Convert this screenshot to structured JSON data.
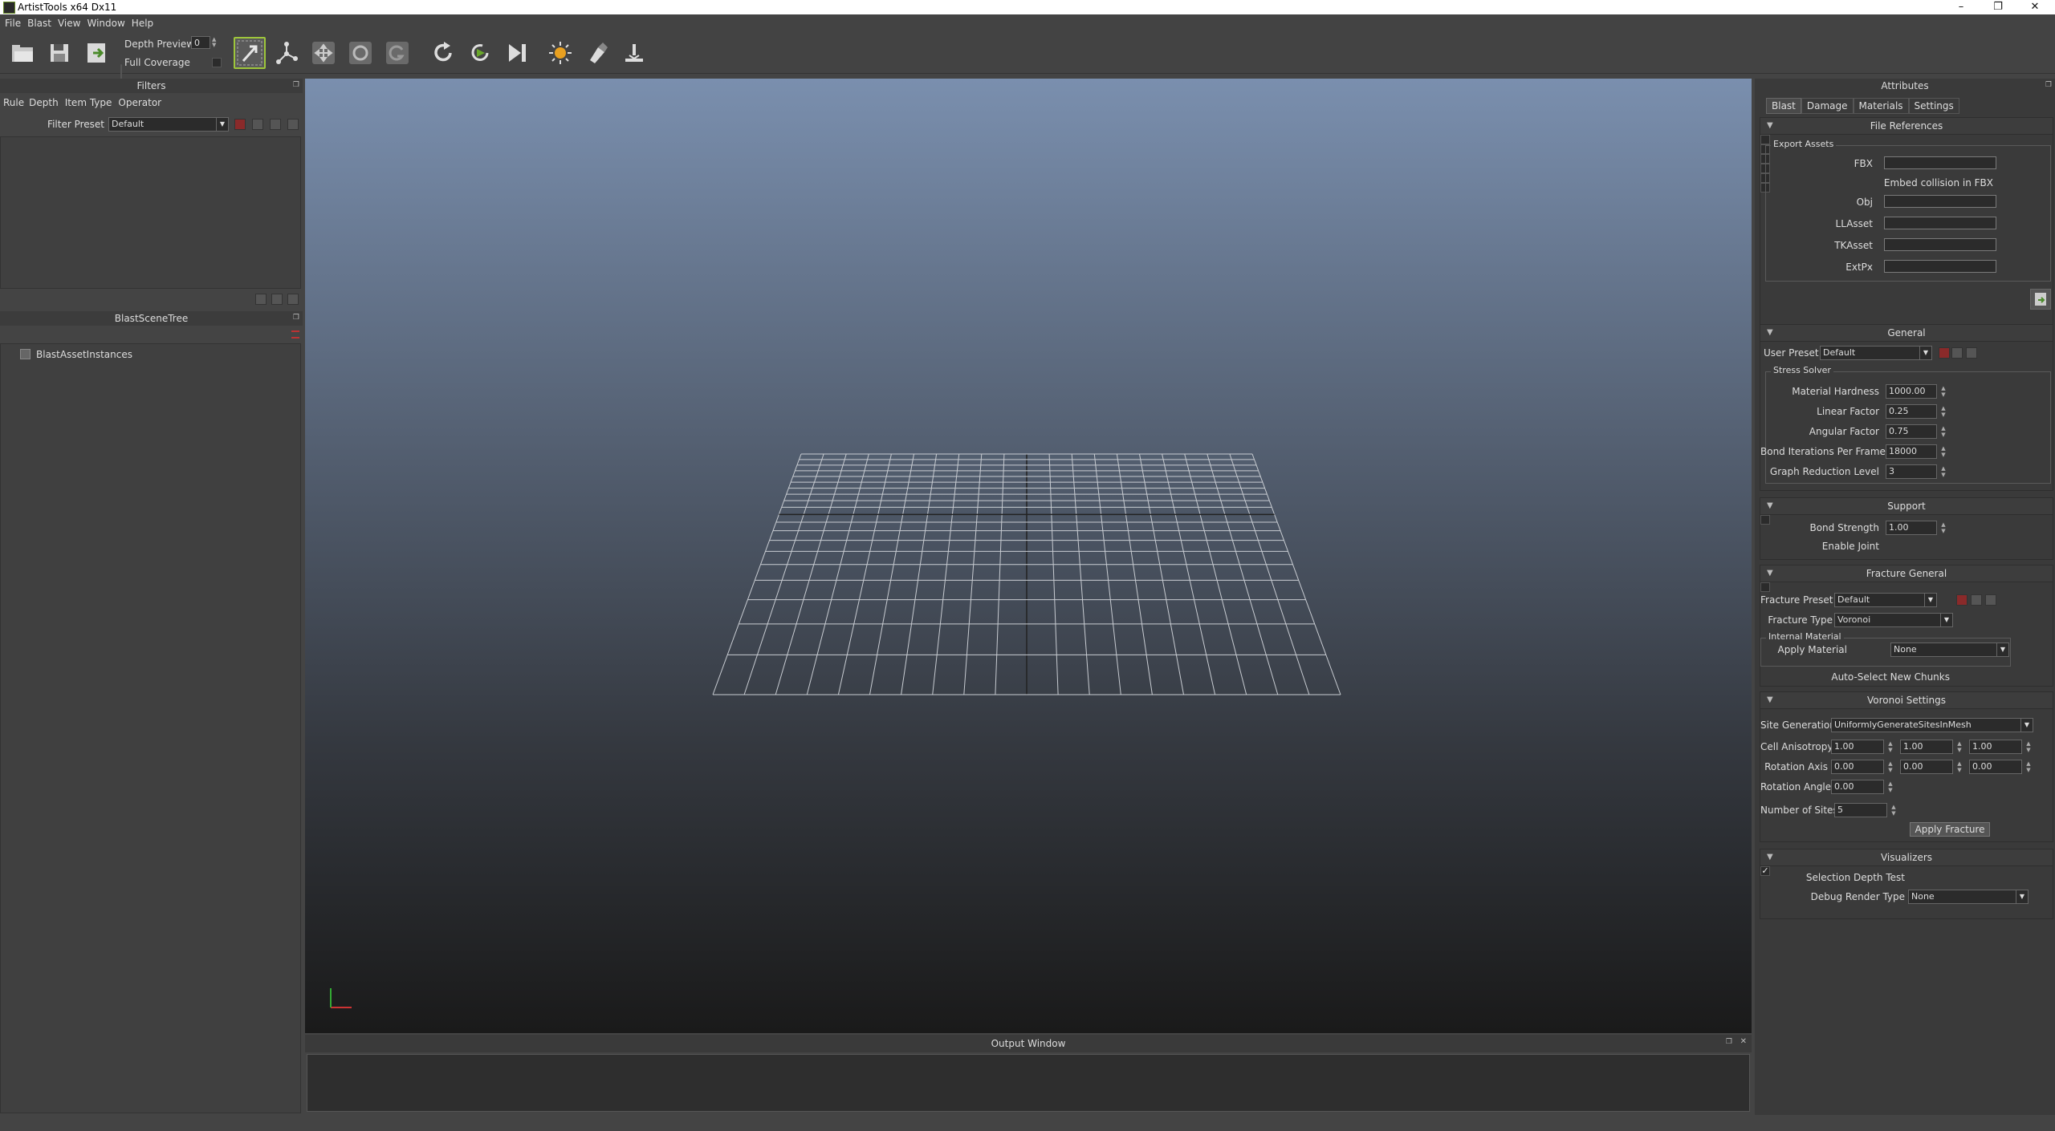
{
  "window": {
    "title": "ArtistTools x64 Dx11",
    "minimize": "–",
    "restore": "❐",
    "close": "✕"
  },
  "menu": [
    "File",
    "Blast",
    "View",
    "Window",
    "Help"
  ],
  "toolbar": {
    "depth_preview_label": "Depth Preview",
    "depth_preview_value": "0",
    "full_coverage_label": "Full Coverage",
    "buttons": [
      "open-icon",
      "save-icon",
      "export-icon",
      "select-icon",
      "graph-icon",
      "move-icon",
      "rotate-icon",
      "scale-icon",
      "refresh-icon",
      "simulate-icon",
      "step-icon",
      "light-icon",
      "paint-icon",
      "fracture-icon"
    ]
  },
  "filters": {
    "title": "Filters",
    "tabs": [
      "Rule",
      "Depth",
      "Item Type",
      "Operator"
    ],
    "preset_label": "Filter Preset",
    "preset_value": "Default"
  },
  "scene_tree": {
    "title": "BlastSceneTree",
    "items": [
      "BlastAssetInstances"
    ]
  },
  "output": {
    "title": "Output Window"
  },
  "attributes": {
    "title": "Attributes",
    "tabs": [
      "Blast",
      "Damage",
      "Materials",
      "Settings"
    ],
    "file_refs": {
      "title": "File References",
      "group": "Export Assets",
      "fbx": "FBX",
      "embed": "Embed collision in FBX",
      "obj": "Obj",
      "llasset": "LLAsset",
      "tkasset": "TKAsset",
      "extpx": "ExtPx"
    },
    "general": {
      "title": "General",
      "user_preset_label": "User Preset",
      "user_preset_value": "Default",
      "stress_solver": "Stress Solver",
      "material_hardness_label": "Material Hardness",
      "material_hardness": "1000.00",
      "linear_factor_label": "Linear Factor",
      "linear_factor": "0.25",
      "angular_factor_label": "Angular Factor",
      "angular_factor": "0.75",
      "bond_iter_label": "Bond Iterations Per Frame",
      "bond_iter": "18000",
      "graph_red_label": "Graph Reduction Level",
      "graph_red": "3"
    },
    "support": {
      "title": "Support",
      "bond_strength_label": "Bond Strength",
      "bond_strength": "1.00",
      "enable_joint_label": "Enable Joint"
    },
    "fracture_general": {
      "title": "Fracture General",
      "preset_label": "Fracture Preset",
      "preset_value": "Default",
      "type_label": "Fracture Type",
      "type_value": "Voronoi",
      "internal_material": "Internal Material",
      "apply_material_label": "Apply Material",
      "apply_material_value": "None",
      "auto_select_label": "Auto-Select New Chunks"
    },
    "voronoi": {
      "title": "Voronoi Settings",
      "site_gen_label": "Site Generation",
      "site_gen_value": "UniformlyGenerateSitesInMesh",
      "cell_aniso_label": "Cell Anisotropy",
      "cell_aniso": [
        "1.00",
        "1.00",
        "1.00"
      ],
      "rot_axis_label": "Rotation Axis",
      "rot_axis": [
        "0.00",
        "0.00",
        "0.00"
      ],
      "rot_angle_label": "Rotation Angle",
      "rot_angle": "0.00",
      "num_sites_label": "Number of Sites",
      "num_sites": "5",
      "apply_button": "Apply Fracture"
    },
    "visualizers": {
      "title": "Visualizers",
      "depth_test_label": "Selection Depth Test",
      "depth_test_check": "✓",
      "debug_render_label": "Debug Render Type",
      "debug_render_value": "None"
    }
  },
  "colors": {
    "accent": "#9ec63b",
    "viewport_top": "#7a8fae",
    "viewport_bottom": "#1c1c1c"
  }
}
